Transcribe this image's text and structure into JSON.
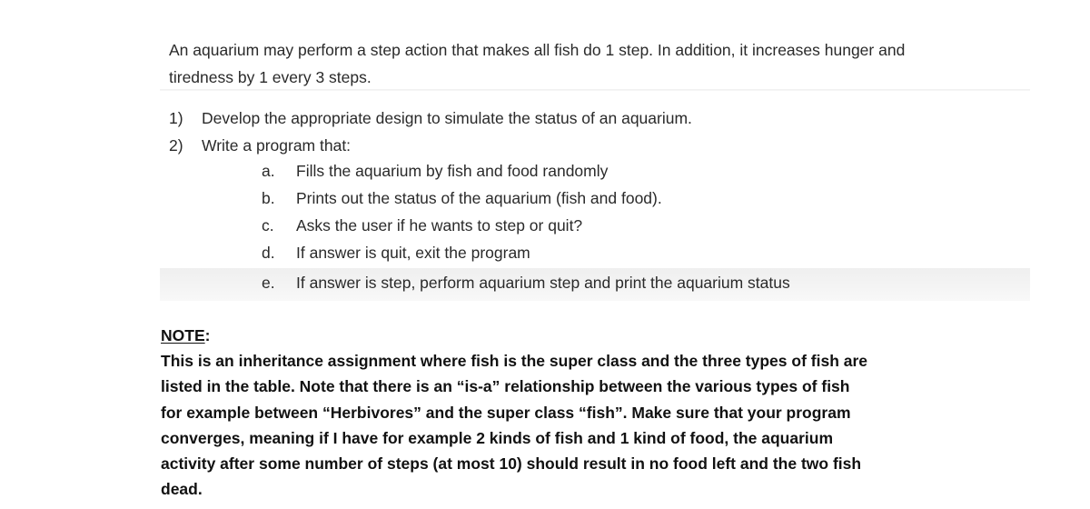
{
  "intro": {
    "lines": [
      "An aquarium may perform a step action that makes all fish do 1 step. In addition, it increases hunger and",
      "tiredness by 1 every 3 steps."
    ]
  },
  "tasks": [
    {
      "marker": "1)",
      "text": "Develop the appropriate design to simulate the status of an aquarium."
    },
    {
      "marker": "2)",
      "text": "Write a program that:"
    }
  ],
  "subtasks": [
    {
      "marker": "a.",
      "text": "Fills the aquarium by fish and food randomly"
    },
    {
      "marker": "b.",
      "text": "Prints out the status of the aquarium (fish and food)."
    },
    {
      "marker": "c.",
      "text": "Asks the user if he wants to step or quit?"
    },
    {
      "marker": "d.",
      "text": "If answer is quit, exit the program"
    },
    {
      "marker": "e.",
      "text": "If answer is step, perform aquarium step and print the aquarium status"
    }
  ],
  "note": {
    "heading": "NOTE",
    "colon": ":",
    "lines": [
      "This is an inheritance assignment where fish is the super class and the three types of fish are",
      "listed in the table. Note that there is an “is-a” relationship between the various types of fish",
      "for example between “Herbivores” and the super class “fish”. Make sure that your program",
      "converges, meaning if I have for example 2 kinds of fish and 1 kind of food, the aquarium",
      "activity after some number of steps (at most 10) should result in no food left and the two fish",
      "dead."
    ]
  }
}
